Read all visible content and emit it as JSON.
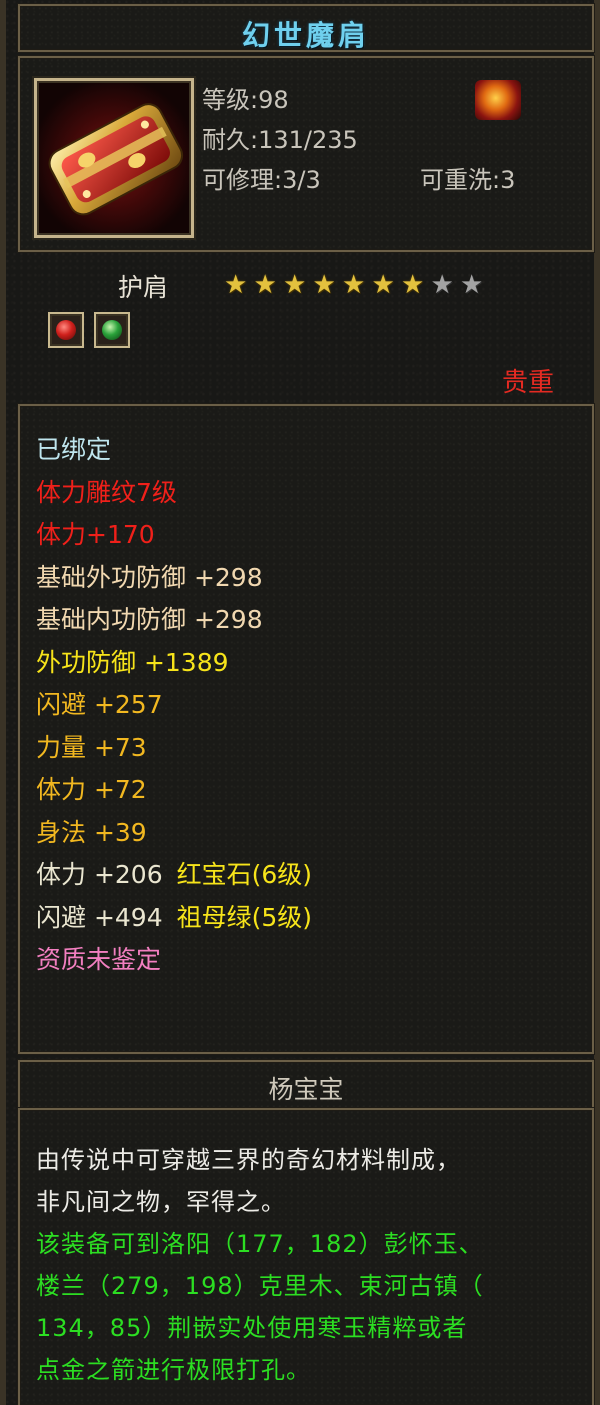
{
  "item": {
    "name": "幻世魔肩",
    "level_text": "等级:98",
    "durability_text": "耐久:131/235",
    "repairable_text": "可修理:3/3",
    "rewash_text": "可重洗:3",
    "type": "护肩",
    "stars_filled": 7,
    "stars_total": 9,
    "rarity": "贵重"
  },
  "gem_slots": [
    {
      "icon": "ruby-gem-icon",
      "color": "#d0201c"
    },
    {
      "icon": "emerald-gem-icon",
      "color": "#2aa23a"
    }
  ],
  "attributes": [
    {
      "text": "已绑定",
      "color": "#bfe6ee"
    },
    {
      "text": "体力雕纹7级",
      "color": "#f0201a"
    },
    {
      "text": "体力+170",
      "color": "#f0201a"
    },
    {
      "text": "基础外功防御 +298",
      "color": "#f1d8b0"
    },
    {
      "text": "基础内功防御 +298",
      "color": "#f1d8b0"
    },
    {
      "text": "外功防御 +1389",
      "color": "#f7e41a"
    },
    {
      "text": "闪避 +257",
      "color": "#f2b820"
    },
    {
      "text": "力量 +73",
      "color": "#f2b820"
    },
    {
      "text": "体力 +72",
      "color": "#f2b820"
    },
    {
      "text": "身法 +39",
      "color": "#f2b820"
    },
    {
      "text": "体力 +206",
      "color": "#eae6d0",
      "gem_text": "红宝石(6级)",
      "gem_color": "#f7e41a"
    },
    {
      "text": "闪避 +494",
      "color": "#eae6d0",
      "gem_text": "祖母绿(5级)",
      "gem_color": "#f7e41a"
    },
    {
      "text": "资质未鉴定",
      "color": "#f27fc0"
    }
  ],
  "maker": "杨宝宝",
  "description": {
    "white_lines": [
      "由传说中可穿越三界的奇幻材料制成，",
      "非凡间之物，罕得之。"
    ],
    "green_lines": [
      "该装备可到洛阳（177，182）彭怀玉、",
      "楼兰（279，198）克里木、束河古镇（",
      "134，85）荆嵌实处使用寒玉精粹或者",
      "点金之箭进行极限打孔。"
    ]
  }
}
